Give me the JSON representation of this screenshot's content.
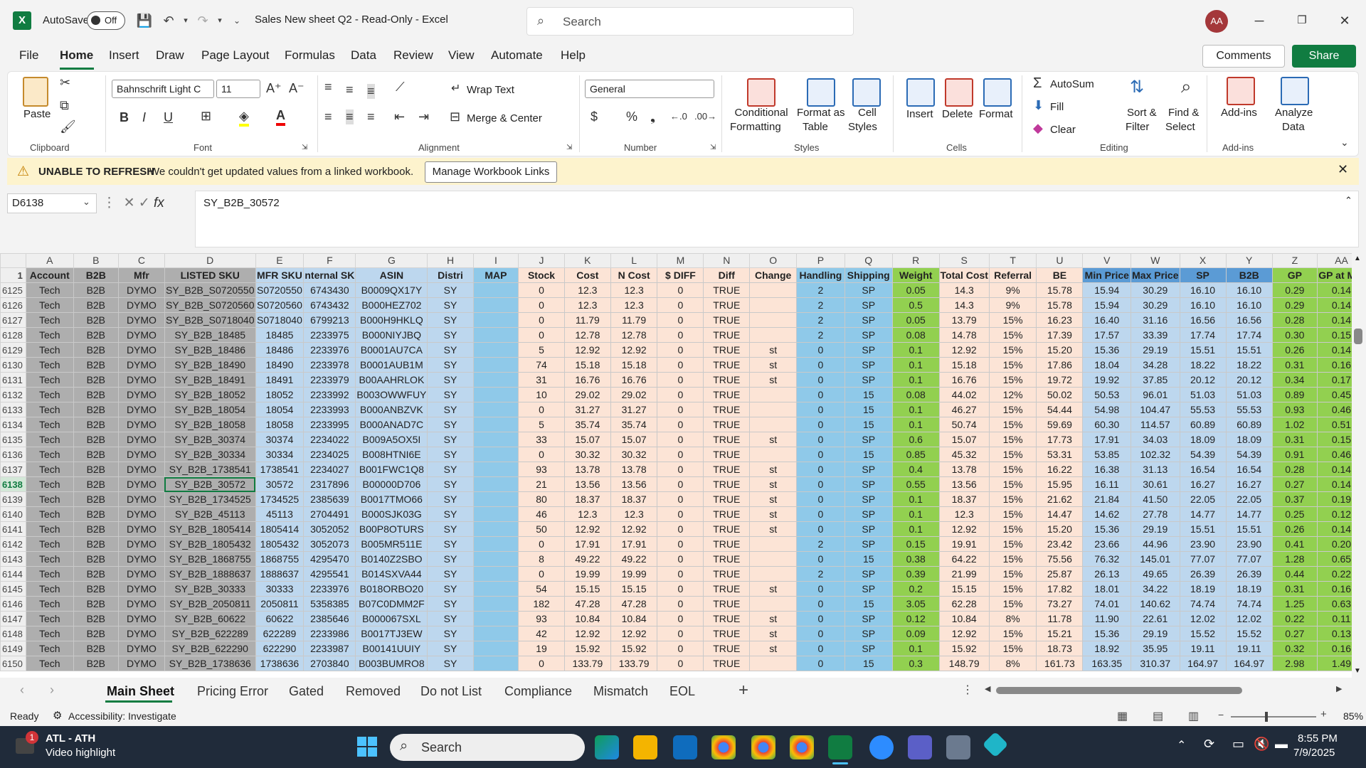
{
  "window": {
    "autosave_label": "AutoSave",
    "autosave_state": "Off",
    "doc_title": "Sales New sheet Q2  -  Read-Only  -  Excel",
    "search_placeholder": "Search",
    "avatar_initials": "AA"
  },
  "menu": [
    "File",
    "Home",
    "Insert",
    "Draw",
    "Page Layout",
    "Formulas",
    "Data",
    "Review",
    "View",
    "Automate",
    "Help"
  ],
  "menu_right": {
    "comments": "Comments",
    "share": "Share"
  },
  "ribbon": {
    "clipboard": {
      "paste": "Paste",
      "label": "Clipboard"
    },
    "font": {
      "name": "Bahnschrift Light C",
      "size": "11",
      "label": "Font"
    },
    "alignment": {
      "wrap": "Wrap Text",
      "merge": "Merge & Center",
      "label": "Alignment"
    },
    "number": {
      "format": "General",
      "label": "Number"
    },
    "styles": {
      "cond": "Conditional",
      "cond2": "Formatting",
      "fmt_table": "Format as",
      "fmt_table2": "Table",
      "cell_styles": "Cell",
      "cell_styles2": "Styles",
      "label": "Styles"
    },
    "cells": {
      "insert": "Insert",
      "delete": "Delete",
      "format": "Format",
      "label": "Cells"
    },
    "editing": {
      "autosum": "AutoSum",
      "fill": "Fill",
      "clear": "Clear",
      "sort": "Sort &",
      "sort2": "Filter",
      "find": "Find &",
      "find2": "Select",
      "label": "Editing"
    },
    "addins": {
      "addins": "Add-ins",
      "label": "Add-ins",
      "analyze": "Analyze",
      "analyze2": "Data"
    }
  },
  "message_bar": {
    "title": "UNABLE TO REFRESH",
    "text": "We couldn't get updated values from a linked workbook.",
    "button": "Manage Workbook Links"
  },
  "formula_bar": {
    "name_box": "D6138",
    "content": "SY_B2B_30572"
  },
  "columns": [
    "A",
    "B",
    "C",
    "D",
    "E",
    "F",
    "G",
    "H",
    "I",
    "J",
    "K",
    "L",
    "M",
    "N",
    "O",
    "P",
    "Q",
    "R",
    "S",
    "T",
    "U",
    "V",
    "W",
    "X",
    "Y",
    "Z",
    "AA"
  ],
  "header_row": {
    "num": "1",
    "cells": [
      "Account",
      "B2B",
      "Mfr",
      "LISTED SKU",
      "MFR SKU",
      "nternal SK",
      "ASIN",
      "Distri",
      "MAP",
      "Stock",
      "Cost",
      "N Cost",
      "$ DIFF",
      "Diff",
      "Change",
      "Handling",
      "Shipping",
      "Weight",
      "Total Cost",
      "Referral",
      "BE",
      "Min Price",
      "Max Price",
      "SP",
      "B2B",
      "GP",
      "GP at Min"
    ]
  },
  "rows": [
    {
      "num": "6125",
      "cells": [
        "Tech",
        "B2B",
        "DYMO",
        "SY_B2B_S0720550",
        "S0720550",
        "6743430",
        "B0009QX17Y",
        "SY",
        "",
        "0",
        "12.3",
        "12.3",
        "0",
        "TRUE",
        "",
        "2",
        "SP",
        "0.05",
        "14.3",
        "9%",
        "15.78",
        "15.94",
        "30.29",
        "16.10",
        "16.10",
        "0.29",
        "0.14"
      ]
    },
    {
      "num": "6126",
      "cells": [
        "Tech",
        "B2B",
        "DYMO",
        "SY_B2B_S0720560",
        "S0720560",
        "6743432",
        "B000HEZ702",
        "SY",
        "",
        "0",
        "12.3",
        "12.3",
        "0",
        "TRUE",
        "",
        "2",
        "SP",
        "0.5",
        "14.3",
        "9%",
        "15.78",
        "15.94",
        "30.29",
        "16.10",
        "16.10",
        "0.29",
        "0.14"
      ]
    },
    {
      "num": "6127",
      "cells": [
        "Tech",
        "B2B",
        "DYMO",
        "SY_B2B_S0718040",
        "S0718040",
        "6799213",
        "B000H9HKLQ",
        "SY",
        "",
        "0",
        "11.79",
        "11.79",
        "0",
        "TRUE",
        "",
        "2",
        "SP",
        "0.05",
        "13.79",
        "15%",
        "16.23",
        "16.40",
        "31.16",
        "16.56",
        "16.56",
        "0.28",
        "0.14"
      ]
    },
    {
      "num": "6128",
      "cells": [
        "Tech",
        "B2B",
        "DYMO",
        "SY_B2B_18485",
        "18485",
        "2233975",
        "B000NIYJBQ",
        "SY",
        "",
        "0",
        "12.78",
        "12.78",
        "0",
        "TRUE",
        "",
        "2",
        "SP",
        "0.08",
        "14.78",
        "15%",
        "17.39",
        "17.57",
        "33.39",
        "17.74",
        "17.74",
        "0.30",
        "0.15"
      ]
    },
    {
      "num": "6129",
      "cells": [
        "Tech",
        "B2B",
        "DYMO",
        "SY_B2B_18486",
        "18486",
        "2233976",
        "B0001AU7CA",
        "SY",
        "",
        "5",
        "12.92",
        "12.92",
        "0",
        "TRUE",
        "st",
        "0",
        "SP",
        "0.1",
        "12.92",
        "15%",
        "15.20",
        "15.36",
        "29.19",
        "15.51",
        "15.51",
        "0.26",
        "0.14"
      ]
    },
    {
      "num": "6130",
      "cells": [
        "Tech",
        "B2B",
        "DYMO",
        "SY_B2B_18490",
        "18490",
        "2233978",
        "B0001AUB1M",
        "SY",
        "",
        "74",
        "15.18",
        "15.18",
        "0",
        "TRUE",
        "st",
        "0",
        "SP",
        "0.1",
        "15.18",
        "15%",
        "17.86",
        "18.04",
        "34.28",
        "18.22",
        "18.22",
        "0.31",
        "0.16"
      ]
    },
    {
      "num": "6131",
      "cells": [
        "Tech",
        "B2B",
        "DYMO",
        "SY_B2B_18491",
        "18491",
        "2233979",
        "B00AAHRLOK",
        "SY",
        "",
        "31",
        "16.76",
        "16.76",
        "0",
        "TRUE",
        "st",
        "0",
        "SP",
        "0.1",
        "16.76",
        "15%",
        "19.72",
        "19.92",
        "37.85",
        "20.12",
        "20.12",
        "0.34",
        "0.17"
      ]
    },
    {
      "num": "6132",
      "cells": [
        "Tech",
        "B2B",
        "DYMO",
        "SY_B2B_18052",
        "18052",
        "2233992",
        "B003OWWFUY",
        "SY",
        "",
        "10",
        "29.02",
        "29.02",
        "0",
        "TRUE",
        "",
        "0",
        "15",
        "0.08",
        "44.02",
        "12%",
        "50.02",
        "50.53",
        "96.01",
        "51.03",
        "51.03",
        "0.89",
        "0.45"
      ]
    },
    {
      "num": "6133",
      "cells": [
        "Tech",
        "B2B",
        "DYMO",
        "SY_B2B_18054",
        "18054",
        "2233993",
        "B000ANBZVK",
        "SY",
        "",
        "0",
        "31.27",
        "31.27",
        "0",
        "TRUE",
        "",
        "0",
        "15",
        "0.1",
        "46.27",
        "15%",
        "54.44",
        "54.98",
        "104.47",
        "55.53",
        "55.53",
        "0.93",
        "0.46"
      ]
    },
    {
      "num": "6134",
      "cells": [
        "Tech",
        "B2B",
        "DYMO",
        "SY_B2B_18058",
        "18058",
        "2233995",
        "B000ANAD7C",
        "SY",
        "",
        "5",
        "35.74",
        "35.74",
        "0",
        "TRUE",
        "",
        "0",
        "15",
        "0.1",
        "50.74",
        "15%",
        "59.69",
        "60.30",
        "114.57",
        "60.89",
        "60.89",
        "1.02",
        "0.51"
      ]
    },
    {
      "num": "6135",
      "cells": [
        "Tech",
        "B2B",
        "DYMO",
        "SY_B2B_30374",
        "30374",
        "2234022",
        "B009A5OX5I",
        "SY",
        "",
        "33",
        "15.07",
        "15.07",
        "0",
        "TRUE",
        "st",
        "0",
        "SP",
        "0.6",
        "15.07",
        "15%",
        "17.73",
        "17.91",
        "34.03",
        "18.09",
        "18.09",
        "0.31",
        "0.15"
      ]
    },
    {
      "num": "6136",
      "cells": [
        "Tech",
        "B2B",
        "DYMO",
        "SY_B2B_30334",
        "30334",
        "2234025",
        "B008HTNI6E",
        "SY",
        "",
        "0",
        "30.32",
        "30.32",
        "0",
        "TRUE",
        "",
        "0",
        "15",
        "0.85",
        "45.32",
        "15%",
        "53.31",
        "53.85",
        "102.32",
        "54.39",
        "54.39",
        "0.91",
        "0.46"
      ]
    },
    {
      "num": "6137",
      "cells": [
        "Tech",
        "B2B",
        "DYMO",
        "SY_B2B_1738541",
        "1738541",
        "2234027",
        "B001FWC1Q8",
        "SY",
        "",
        "93",
        "13.78",
        "13.78",
        "0",
        "TRUE",
        "st",
        "0",
        "SP",
        "0.4",
        "13.78",
        "15%",
        "16.22",
        "16.38",
        "31.13",
        "16.54",
        "16.54",
        "0.28",
        "0.14"
      ]
    },
    {
      "num": "6138",
      "cells": [
        "Tech",
        "B2B",
        "DYMO",
        "SY_B2B_30572",
        "30572",
        "2317896",
        "B00000D706",
        "SY",
        "",
        "21",
        "13.56",
        "13.56",
        "0",
        "TRUE",
        "st",
        "0",
        "SP",
        "0.55",
        "13.56",
        "15%",
        "15.95",
        "16.11",
        "30.61",
        "16.27",
        "16.27",
        "0.27",
        "0.14"
      ]
    },
    {
      "num": "6139",
      "cells": [
        "Tech",
        "B2B",
        "DYMO",
        "SY_B2B_1734525",
        "1734525",
        "2385639",
        "B0017TMO66",
        "SY",
        "",
        "80",
        "18.37",
        "18.37",
        "0",
        "TRUE",
        "st",
        "0",
        "SP",
        "0.1",
        "18.37",
        "15%",
        "21.62",
        "21.84",
        "41.50",
        "22.05",
        "22.05",
        "0.37",
        "0.19"
      ]
    },
    {
      "num": "6140",
      "cells": [
        "Tech",
        "B2B",
        "DYMO",
        "SY_B2B_45113",
        "45113",
        "2704491",
        "B000SJK03G",
        "SY",
        "",
        "46",
        "12.3",
        "12.3",
        "0",
        "TRUE",
        "st",
        "0",
        "SP",
        "0.1",
        "12.3",
        "15%",
        "14.47",
        "14.62",
        "27.78",
        "14.77",
        "14.77",
        "0.25",
        "0.12"
      ]
    },
    {
      "num": "6141",
      "cells": [
        "Tech",
        "B2B",
        "DYMO",
        "SY_B2B_1805414",
        "1805414",
        "3052052",
        "B00P8OTURS",
        "SY",
        "",
        "50",
        "12.92",
        "12.92",
        "0",
        "TRUE",
        "st",
        "0",
        "SP",
        "0.1",
        "12.92",
        "15%",
        "15.20",
        "15.36",
        "29.19",
        "15.51",
        "15.51",
        "0.26",
        "0.14"
      ]
    },
    {
      "num": "6142",
      "cells": [
        "Tech",
        "B2B",
        "DYMO",
        "SY_B2B_1805432",
        "1805432",
        "3052073",
        "B005MR511E",
        "SY",
        "",
        "0",
        "17.91",
        "17.91",
        "0",
        "TRUE",
        "",
        "2",
        "SP",
        "0.15",
        "19.91",
        "15%",
        "23.42",
        "23.66",
        "44.96",
        "23.90",
        "23.90",
        "0.41",
        "0.20"
      ]
    },
    {
      "num": "6143",
      "cells": [
        "Tech",
        "B2B",
        "DYMO",
        "SY_B2B_1868755",
        "1868755",
        "4295470",
        "B0140Z2SBO",
        "SY",
        "",
        "8",
        "49.22",
        "49.22",
        "0",
        "TRUE",
        "",
        "0",
        "15",
        "0.38",
        "64.22",
        "15%",
        "75.56",
        "76.32",
        "145.01",
        "77.07",
        "77.07",
        "1.28",
        "0.65"
      ]
    },
    {
      "num": "6144",
      "cells": [
        "Tech",
        "B2B",
        "DYMO",
        "SY_B2B_1888637",
        "1888637",
        "4295541",
        "B014SXVA44",
        "SY",
        "",
        "0",
        "19.99",
        "19.99",
        "0",
        "TRUE",
        "",
        "2",
        "SP",
        "0.39",
        "21.99",
        "15%",
        "25.87",
        "26.13",
        "49.65",
        "26.39",
        "26.39",
        "0.44",
        "0.22"
      ]
    },
    {
      "num": "6145",
      "cells": [
        "Tech",
        "B2B",
        "DYMO",
        "SY_B2B_30333",
        "30333",
        "2233976",
        "B018ORBO20",
        "SY",
        "",
        "54",
        "15.15",
        "15.15",
        "0",
        "TRUE",
        "st",
        "0",
        "SP",
        "0.2",
        "15.15",
        "15%",
        "17.82",
        "18.01",
        "34.22",
        "18.19",
        "18.19",
        "0.31",
        "0.16"
      ]
    },
    {
      "num": "6146",
      "cells": [
        "Tech",
        "B2B",
        "DYMO",
        "SY_B2B_2050811",
        "2050811",
        "5358385",
        "B07C0DMM2F",
        "SY",
        "",
        "182",
        "47.28",
        "47.28",
        "0",
        "TRUE",
        "",
        "0",
        "15",
        "3.05",
        "62.28",
        "15%",
        "73.27",
        "74.01",
        "140.62",
        "74.74",
        "74.74",
        "1.25",
        "0.63"
      ]
    },
    {
      "num": "6147",
      "cells": [
        "Tech",
        "B2B",
        "DYMO",
        "SY_B2B_60622",
        "60622",
        "2385646",
        "B000067SXL",
        "SY",
        "",
        "93",
        "10.84",
        "10.84",
        "0",
        "TRUE",
        "st",
        "0",
        "SP",
        "0.12",
        "10.84",
        "8%",
        "11.78",
        "11.90",
        "22.61",
        "12.02",
        "12.02",
        "0.22",
        "0.11"
      ]
    },
    {
      "num": "6148",
      "cells": [
        "Tech",
        "B2B",
        "DYMO",
        "SY_B2B_622289",
        "622289",
        "2233986",
        "B0017TJ3EW",
        "SY",
        "",
        "42",
        "12.92",
        "12.92",
        "0",
        "TRUE",
        "st",
        "0",
        "SP",
        "0.09",
        "12.92",
        "15%",
        "15.21",
        "15.36",
        "29.19",
        "15.52",
        "15.52",
        "0.27",
        "0.13"
      ]
    },
    {
      "num": "6149",
      "cells": [
        "Tech",
        "B2B",
        "DYMO",
        "SY_B2B_622290",
        "622290",
        "2233987",
        "B00141UUIY",
        "SY",
        "",
        "19",
        "15.92",
        "15.92",
        "0",
        "TRUE",
        "st",
        "0",
        "SP",
        "0.1",
        "15.92",
        "15%",
        "18.73",
        "18.92",
        "35.95",
        "19.11",
        "19.11",
        "0.32",
        "0.16"
      ]
    },
    {
      "num": "6150",
      "cells": [
        "Tech",
        "B2B",
        "DYMO",
        "SY_B2B_1738636",
        "1738636",
        "2703840",
        "B003BUMRO8",
        "SY",
        "",
        "0",
        "133.79",
        "133.79",
        "0",
        "TRUE",
        "",
        "0",
        "15",
        "0.3",
        "148.79",
        "8%",
        "161.73",
        "163.35",
        "310.37",
        "164.97",
        "164.97",
        "2.98",
        "1.49"
      ]
    }
  ],
  "selected_row": "6138",
  "sheet_tabs": [
    "Main Sheet",
    "Pricing Error",
    "Gated",
    "Removed",
    "Do not List",
    "Compliance",
    "Mismatch",
    "EOL"
  ],
  "status": {
    "ready": "Ready",
    "accessibility": "Accessibility: Investigate",
    "zoom": "85%"
  },
  "taskbar": {
    "news_title": "ATL - ATH",
    "news_sub": "Video highlight",
    "search": "Search",
    "time": "8:55 PM",
    "date": "7/9/2025",
    "badge": "1"
  },
  "colors": {
    "excel_green": "#107c41",
    "header_gray": "#aeaeae",
    "blue": "#bdd7ee",
    "sky": "#8fc9e9",
    "peach": "#fce4d6",
    "green": "#92d050"
  }
}
